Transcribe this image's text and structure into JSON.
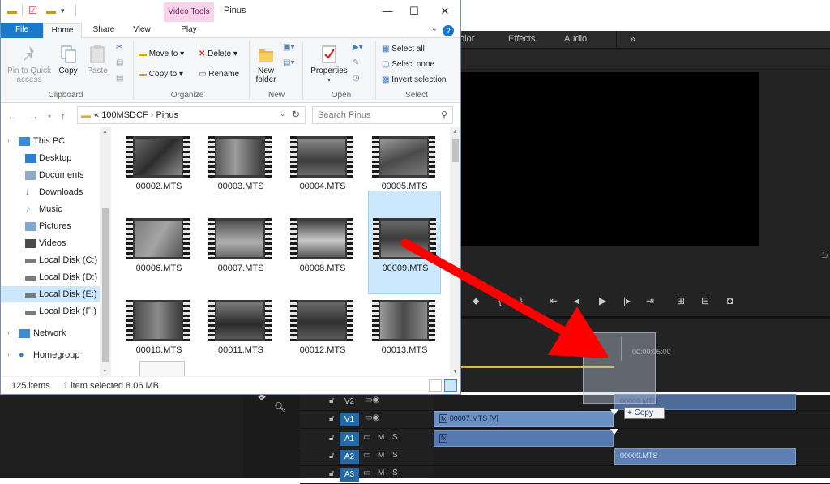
{
  "explorer": {
    "window_title": "Pinus",
    "context_tab_group": "Video Tools",
    "tabs": {
      "file": "File",
      "home": "Home",
      "share": "Share",
      "view": "View",
      "play": "Play"
    },
    "ribbon": {
      "clipboard": {
        "label": "Clipboard",
        "pin": "Pin to Quick access",
        "copy": "Copy",
        "paste": "Paste"
      },
      "organize": {
        "label": "Organize",
        "move_to": "Move to",
        "copy_to": "Copy to",
        "delete": "Delete",
        "rename": "Rename"
      },
      "new": {
        "label": "New",
        "new_folder": "New folder"
      },
      "open": {
        "label": "Open",
        "properties": "Properties"
      },
      "select": {
        "label": "Select",
        "select_all": "Select all",
        "select_none": "Select none",
        "invert_selection": "Invert selection"
      }
    },
    "address": {
      "prefix": "«",
      "part1": "100MSDCF",
      "sep": "›",
      "part2": "Pinus"
    },
    "search": {
      "placeholder": "Search Pinus"
    },
    "nav": [
      {
        "label": "This PC"
      },
      {
        "label": "Desktop"
      },
      {
        "label": "Documents"
      },
      {
        "label": "Downloads"
      },
      {
        "label": "Music"
      },
      {
        "label": "Pictures"
      },
      {
        "label": "Videos"
      },
      {
        "label": "Local Disk (C:)"
      },
      {
        "label": "Local Disk (D:)"
      },
      {
        "label": "Local Disk (E:)"
      },
      {
        "label": "Local Disk (F:)"
      },
      {
        "label": "Network"
      },
      {
        "label": "Homegroup"
      }
    ],
    "files": [
      {
        "name": "00002.MTS"
      },
      {
        "name": "00003.MTS"
      },
      {
        "name": "00004.MTS"
      },
      {
        "name": "00005.MTS"
      },
      {
        "name": "00006.MTS"
      },
      {
        "name": "00007.MTS"
      },
      {
        "name": "00008.MTS"
      },
      {
        "name": "00009.MTS"
      },
      {
        "name": "00010.MTS"
      },
      {
        "name": "00011.MTS"
      },
      {
        "name": "00012.MTS"
      },
      {
        "name": "00013.MTS"
      }
    ],
    "selected_file": "00009.MTS",
    "status": {
      "items": "125 items",
      "selection": "1 item selected  8.06 MB"
    }
  },
  "premiere": {
    "panel_tabs": {
      "color": "olor",
      "effects": "Effects",
      "audio": "Audio",
      "more": "»"
    },
    "timecode": "00:00:05:00",
    "side_fraction": "1/",
    "tracks": [
      {
        "label": "V2"
      },
      {
        "label": "V1"
      },
      {
        "label": "A1"
      },
      {
        "label": "A2"
      },
      {
        "label": "A3"
      }
    ],
    "track_toggles": {
      "m": "M",
      "s": "S"
    },
    "clips": {
      "v1_clip": "00007.MTS [V]",
      "v2_clip": "00009.MTS",
      "a2_clip": "00009.MTS",
      "fx": "fx"
    },
    "copy_tooltip": "+ Copy"
  },
  "colors": {
    "accent": "#1979ca",
    "arrow": "#ff0000",
    "clip": "#6a8fc4",
    "selection": "#cce8ff"
  }
}
